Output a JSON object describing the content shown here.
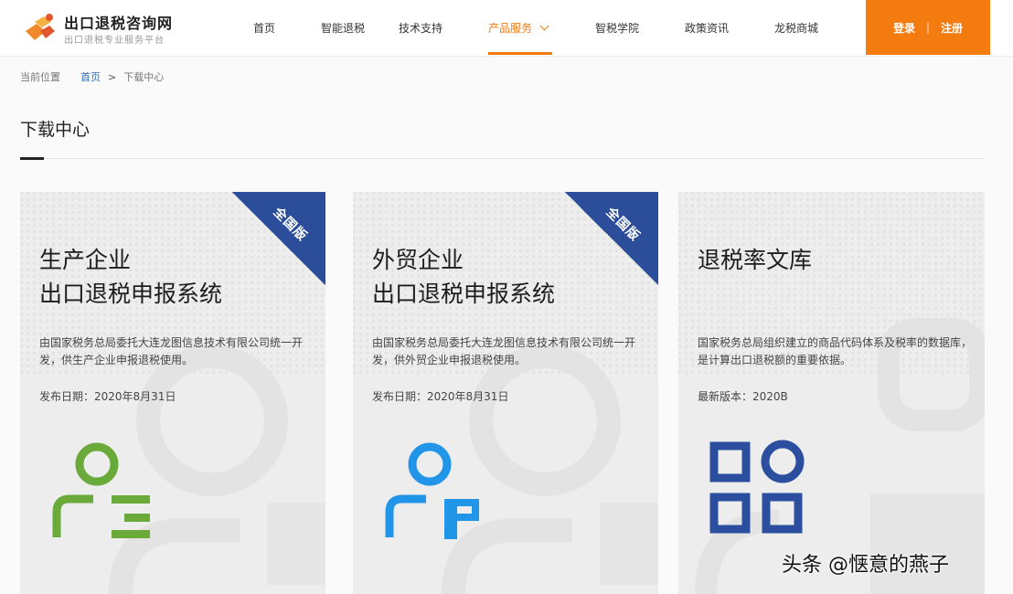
{
  "brand": {
    "title": "出口退税咨询网",
    "subtitle": "出口退税专业服务平台"
  },
  "nav": {
    "items": [
      {
        "label": "首页"
      },
      {
        "label": "智能退税"
      },
      {
        "label": "技术支持"
      },
      {
        "label": "产品服务",
        "active": true
      },
      {
        "label": "智税学院"
      },
      {
        "label": "政策资讯"
      },
      {
        "label": "龙税商城"
      }
    ],
    "login": "登录",
    "divider": "|",
    "register": "注册"
  },
  "breadcrumb": {
    "current_label": "当前位置",
    "home": "首页",
    "separator": ">",
    "page": "下载中心"
  },
  "page": {
    "title": "下载中心"
  },
  "cards": [
    {
      "badge": "全国版",
      "title_line1": "生产企业",
      "title_line2": "出口退税申报系统",
      "desc": "由国家税务总局委托大连龙图信息技术有限公司统一开发，供生产企业申报退税使用。",
      "meta": "发布日期：2020年8月31日",
      "icon": "user-list-icon",
      "icon_color": "#6aaa3a"
    },
    {
      "badge": "全国版",
      "title_line1": "外贸企业",
      "title_line2": "出口退税申报系统",
      "desc": "由国家税务总局委托大连龙图信息技术有限公司统一开发，供外贸企业申报退税使用。",
      "meta": "发布日期：2020年8月31日",
      "icon": "user-document-icon",
      "icon_color": "#2196e8"
    },
    {
      "title_line1": "退税率文库",
      "desc": "国家税务总局组织建立的商品代码体系及税率的数据库，是计算出口退税额的重要依据。",
      "meta": "最新版本：2020B",
      "icon": "grid-apps-icon",
      "icon_color": "#2b4f9e"
    }
  ],
  "watermark": "头条 @惬意的燕子",
  "colors": {
    "accent": "#f47b10",
    "ribbon": "#2c4e9a",
    "link": "#2f6db5"
  }
}
